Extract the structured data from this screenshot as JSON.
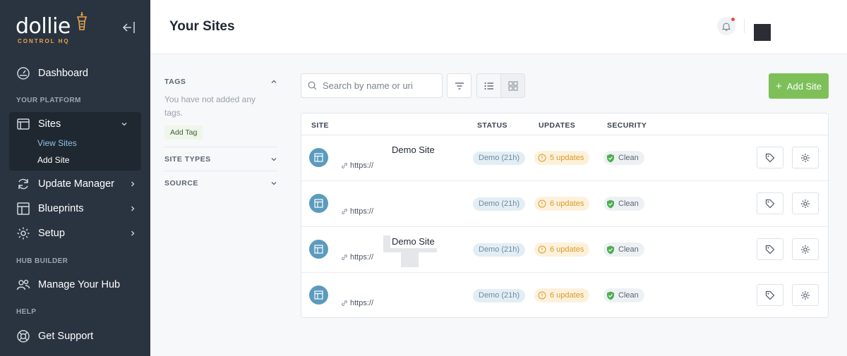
{
  "brand": {
    "name": "dollie",
    "subtitle": "CONTROL HQ",
    "accent": "#e9a34d"
  },
  "sidebar": {
    "dashboard": "Dashboard",
    "section_platform": "YOUR PLATFORM",
    "sites": {
      "label": "Sites",
      "sub": [
        "View Sites",
        "Add Site"
      ]
    },
    "update_manager": "Update Manager",
    "blueprints": "Blueprints",
    "setup": "Setup",
    "section_hub": "HUB BUILDER",
    "manage_hub": "Manage Your Hub",
    "section_help": "HELP",
    "support": "Get Support"
  },
  "header": {
    "title": "Your Sites"
  },
  "filters": {
    "tags": {
      "title": "TAGS",
      "empty_text": "You have not added any tags.",
      "add_label": "Add Tag"
    },
    "site_types": {
      "title": "SITE TYPES"
    },
    "source": {
      "title": "SOURCE"
    }
  },
  "toolbar": {
    "search_placeholder": "Search by name or uri",
    "add_site": "Add Site",
    "add_color": "#7dc05a"
  },
  "table": {
    "columns": [
      "SITE",
      "STATUS",
      "UPDATES",
      "SECURITY"
    ],
    "rows": [
      {
        "name": "Demo Site",
        "url": "https://",
        "status": "Demo (21h)",
        "updates": "5 updates",
        "security": "Clean"
      },
      {
        "name": "",
        "url": "https://",
        "status": "Demo (21h)",
        "updates": "6 updates",
        "security": "Clean"
      },
      {
        "name": "Demo Site",
        "url": "https://",
        "status": "Demo (21h)",
        "updates": "6 updates",
        "security": "Clean"
      },
      {
        "name": "",
        "url": "https://",
        "status": "Demo (21h)",
        "updates": "6 updates",
        "security": "Clean"
      }
    ]
  }
}
